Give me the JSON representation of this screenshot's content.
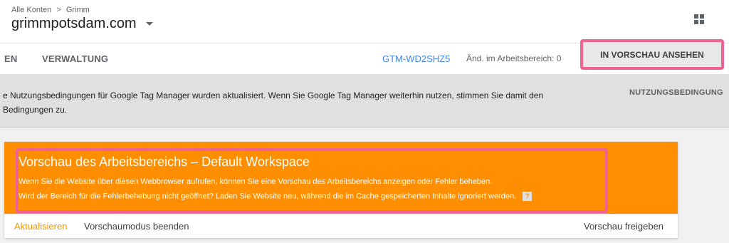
{
  "breadcrumb": {
    "accounts": "Alle Konten",
    "separator": ">",
    "account": "Grimm"
  },
  "container": {
    "name": "grimmpotsdam.com"
  },
  "nav": {
    "tab_partial": "EN",
    "tab_admin": "VERWALTUNG",
    "container_id": "GTM-WD2SHZ5",
    "workspace_changes": "Änd. im Arbeitsbereich: 0",
    "preview_button": "IN VORSCHAU ANSEHEN"
  },
  "notice": {
    "text": "e Nutzungsbedingungen für Google Tag Manager wurden aktualisiert. Wenn Sie Google Tag Manager weiterhin nutzen, stimmen Sie damit den\nBedingungen zu.",
    "link": "NUTZUNGSBEDINGUNG"
  },
  "preview_panel": {
    "title": "Vorschau des Arbeitsbereichs – Default Workspace",
    "line1": "Wenn Sie die Website über diesen Webbrowser aufrufen, können Sie eine Vorschau des Arbeitsbereichs anzeigen oder Fehler beheben.",
    "line2": "Wird der Bereich für die Fehlerbehebung nicht geöffnet? Laden Sie Website neu, während die im Cache gespeicherten Inhalte ignoriert werden.",
    "help_glyph": "?",
    "refresh": "Aktualisieren",
    "exit": "Vorschaumodus beenden",
    "share": "Vorschau freigeben"
  }
}
